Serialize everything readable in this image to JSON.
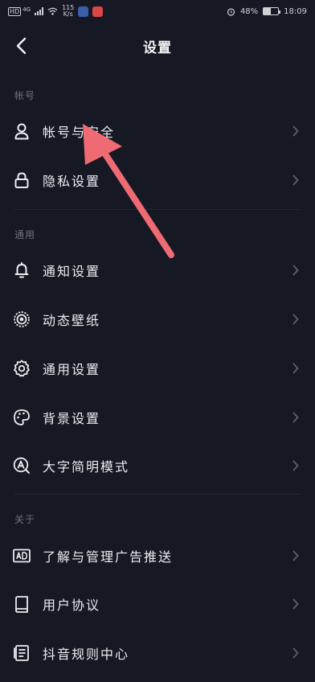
{
  "status_bar": {
    "network": "HD",
    "network_gen": "4G",
    "speed_value": "115",
    "speed_unit": "K/s",
    "battery_percent": "48%",
    "time": "18:09",
    "battery_level": 0.48
  },
  "header": {
    "title": "设置"
  },
  "sections": [
    {
      "title": "帐号",
      "items": [
        {
          "label": "帐号与安全",
          "icon": "user-icon"
        },
        {
          "label": "隐私设置",
          "icon": "lock-icon"
        }
      ]
    },
    {
      "title": "通用",
      "items": [
        {
          "label": "通知设置",
          "icon": "bell-icon"
        },
        {
          "label": "动态壁纸",
          "icon": "wallpaper-icon"
        },
        {
          "label": "通用设置",
          "icon": "gear-icon"
        },
        {
          "label": "背景设置",
          "icon": "palette-icon"
        },
        {
          "label": "大字简明模式",
          "icon": "font-size-icon"
        }
      ]
    },
    {
      "title": "关于",
      "items": [
        {
          "label": "了解与管理广告推送",
          "icon": "ad-icon"
        },
        {
          "label": "用户协议",
          "icon": "book-icon"
        },
        {
          "label": "抖音规则中心",
          "icon": "document-icon"
        }
      ]
    }
  ],
  "colors": {
    "background": "#161823",
    "text": "#ececf0",
    "section_header": "#6f7180",
    "chevron": "#5d5f6c",
    "annotation_arrow": "#ef6b74"
  }
}
